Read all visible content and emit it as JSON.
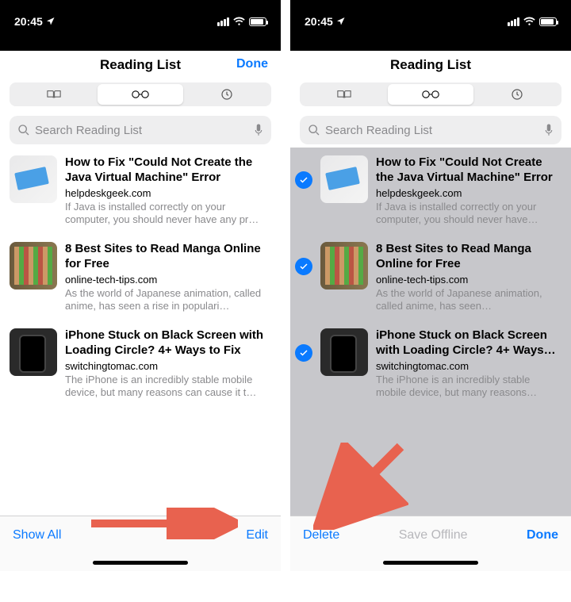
{
  "status": {
    "time": "20:45"
  },
  "header": {
    "title": "Reading List",
    "done": "Done"
  },
  "search": {
    "placeholder": "Search Reading List"
  },
  "items": [
    {
      "title": "How to Fix \"Could Not Create the Java Virtual Machine\" Error",
      "domain": "helpdeskgeek.com",
      "desc": "If Java is installed correctly on your computer, you should never have any pr…"
    },
    {
      "title": "8 Best Sites to Read Manga Online for Free",
      "domain": "online-tech-tips.com",
      "desc": "As the world of Japanese animation, called anime, has seen a rise in populari…"
    },
    {
      "title": "iPhone Stuck on Black Screen with Loading Circle? 4+ Ways to Fix",
      "domain": "switchingtomac.com",
      "desc": "The iPhone is an incredibly stable mobile device, but many reasons can cause it t…"
    }
  ],
  "items_sel": [
    {
      "title": "How to Fix \"Could Not Create the Java Virtual Machine\" Error",
      "domain": "helpdeskgeek.com",
      "desc": "If Java is installed correctly on your computer, you should never have…"
    },
    {
      "title": "8 Best Sites to Read Manga Online for Free",
      "domain": "online-tech-tips.com",
      "desc": "As the world of Japanese animation, called anime, has seen…"
    },
    {
      "title": "iPhone Stuck on Black Screen with Loading Circle? 4+ Ways…",
      "domain": "switchingtomac.com",
      "desc": "The iPhone is an incredibly stable mobile device, but many reasons…"
    }
  ],
  "toolbar_left": {
    "showall": "Show All",
    "edit": "Edit"
  },
  "toolbar_right": {
    "delete": "Delete",
    "save": "Save Offline",
    "done": "Done"
  }
}
